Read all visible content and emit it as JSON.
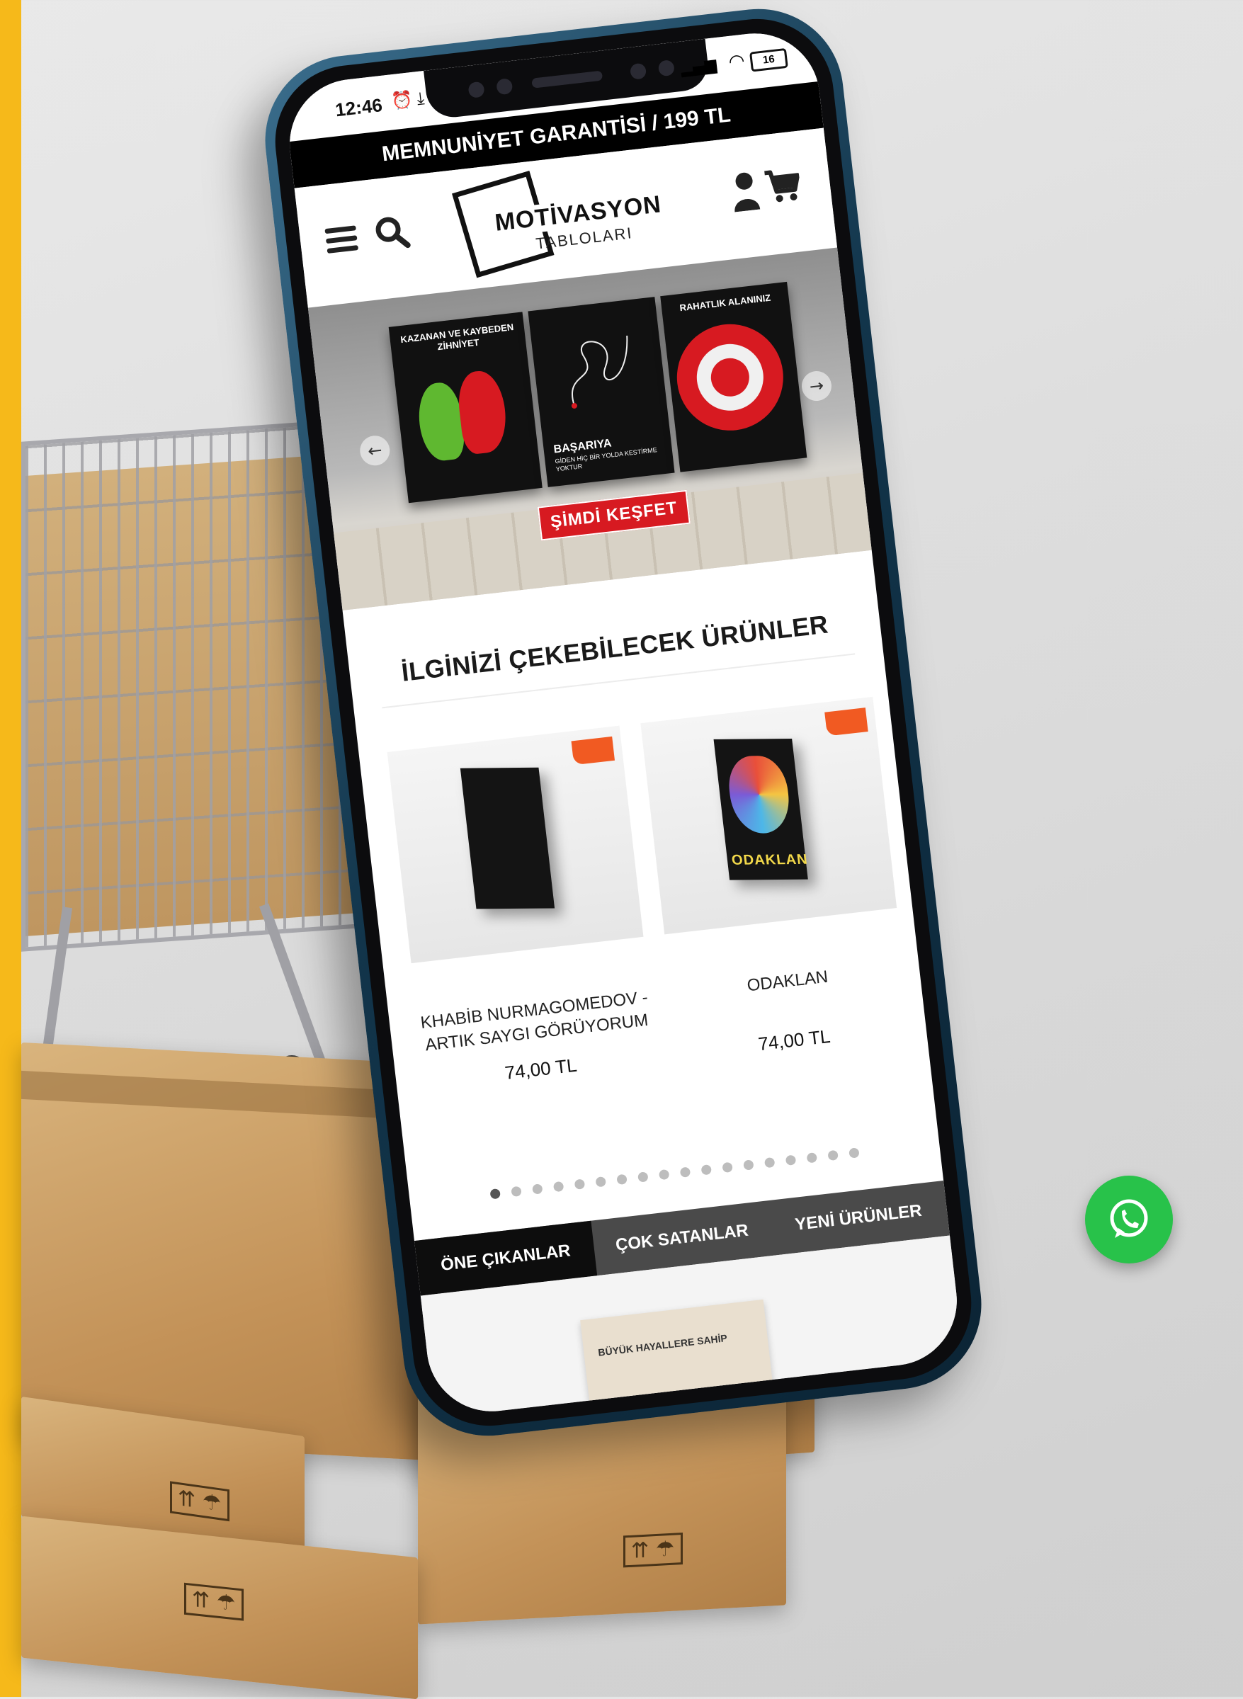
{
  "status_bar": {
    "time": "12:46",
    "alarm_icon": "alarm-icon",
    "download_icon": "download-icon",
    "battery": "16"
  },
  "announcement": {
    "text": "MEMNUNİYET GARANTİSİ / 199 TL"
  },
  "header": {
    "logo_line1": "MOTİVASYON",
    "logo_line2": "TABLOLARI",
    "menu_icon": "hamburger-menu-icon",
    "search_icon": "search-icon",
    "user_icon": "user-icon",
    "cart_icon": "shopping-cart-icon"
  },
  "hero": {
    "posters": [
      {
        "title": "KAZANAN VE KAYBEDEN ZİHNİYET"
      },
      {
        "title": "BAŞARIYA",
        "subtitle": "GİDEN HİÇ BİR YOLDA KESTİRME YOKTUR"
      },
      {
        "title": "RAHATLIK ALANINIZ"
      }
    ],
    "cta": "ŞİMDİ KEŞFET",
    "prev_arrow": "←",
    "next_arrow": "→"
  },
  "section": {
    "title": "İLGİNİZİ ÇEKEBİLECEK ÜRÜNLER"
  },
  "products": [
    {
      "name": "KHABİB NURMAGOMEDOV - ARTIK SAYGI GÖRÜYORUM",
      "price": "74,00 TL"
    },
    {
      "name": "ODAKLAN",
      "price": "74,00 TL",
      "art_text": "ODAKLAN"
    }
  ],
  "carousel": {
    "total_dots": 18,
    "active_index": 0
  },
  "tabs": [
    {
      "label": "ÖNE ÇIKANLAR",
      "active": true
    },
    {
      "label": "ÇOK SATANLAR",
      "active": false
    },
    {
      "label": "YENİ ÜRÜNLER",
      "active": false
    }
  ],
  "bottom_poster_text": "BÜYÜK HAYALLERE SAHİP",
  "whatsapp_icon": "whatsapp-icon",
  "colors": {
    "accent_yellow": "#f6b91a",
    "brand_red": "#d71a21",
    "phone_blue": "#12354b",
    "whatsapp_green": "#28c24a",
    "badge_orange": "#f15a22"
  }
}
